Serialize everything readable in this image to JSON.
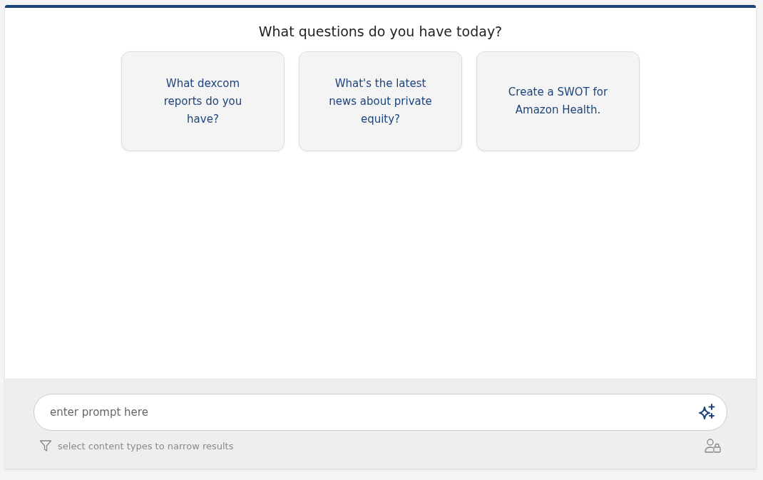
{
  "heading": "What questions do you have today?",
  "suggestions": [
    {
      "text": "What dexcom reports do you have?"
    },
    {
      "text": "What's the latest news about private equity?"
    },
    {
      "text": "Create a SWOT for Amazon Health."
    }
  ],
  "prompt": {
    "placeholder": "enter prompt here"
  },
  "filter_hint": "select content types to narrow results"
}
